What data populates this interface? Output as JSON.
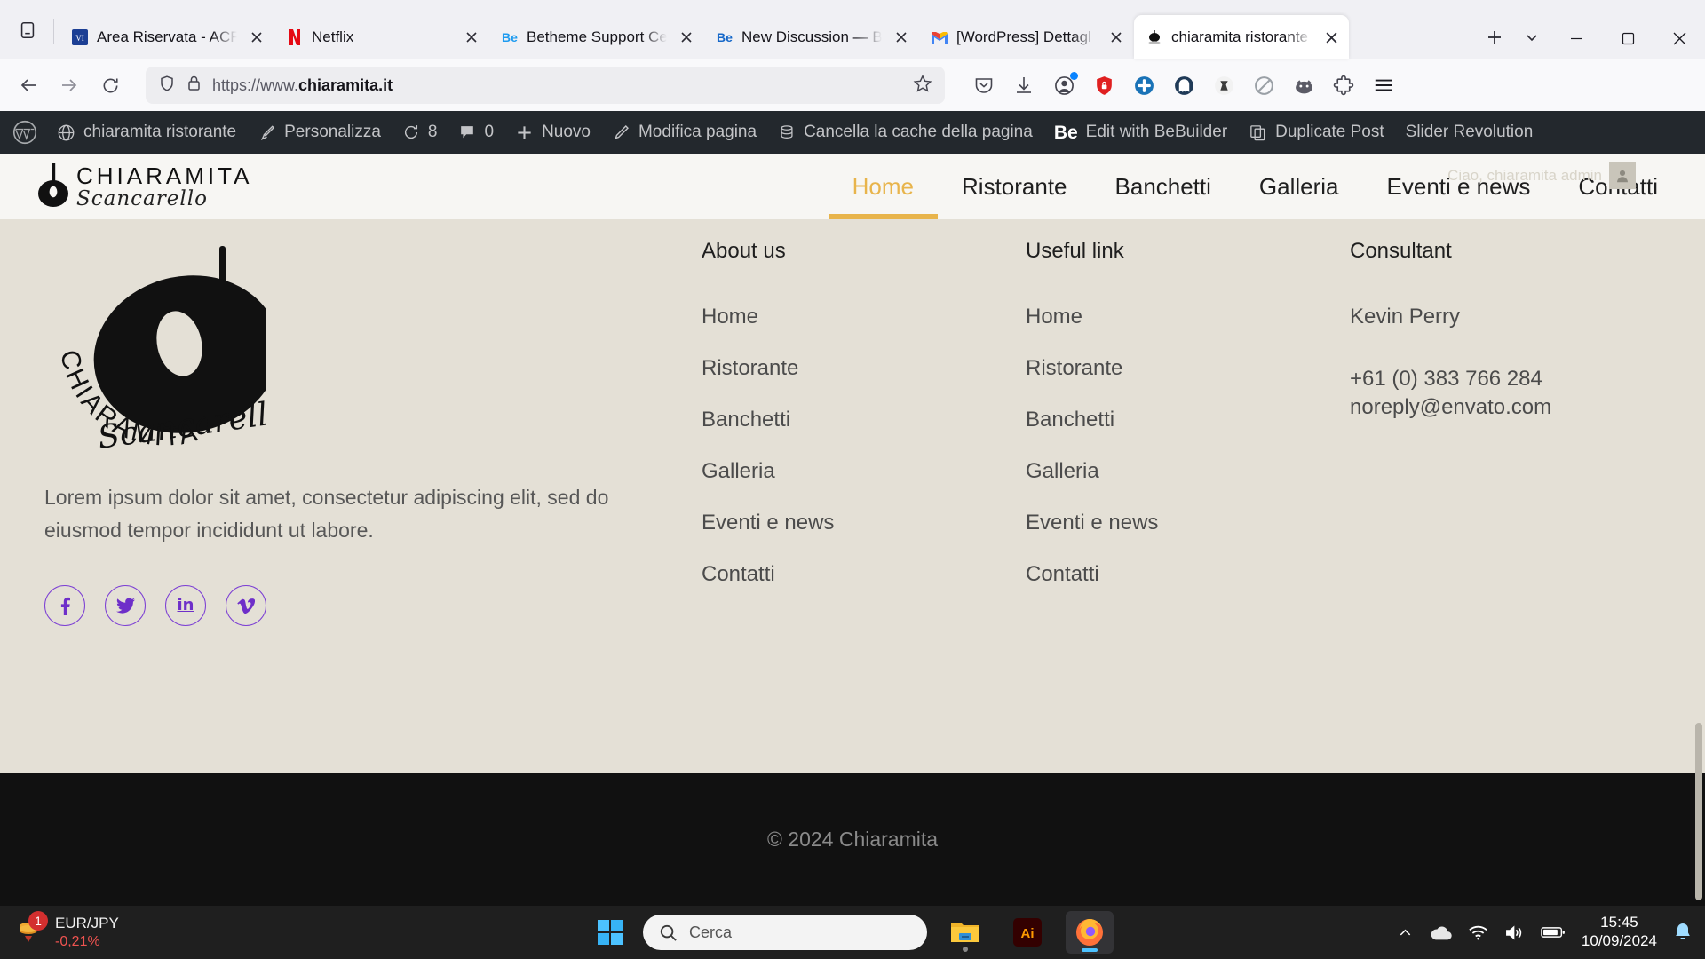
{
  "browser": {
    "tabs": [
      {
        "title": "Area Riservata - ACF",
        "favicon": "wordpress-vip-icon",
        "active": false
      },
      {
        "title": "Netflix",
        "favicon": "netflix-icon",
        "active": false
      },
      {
        "title": "Betheme Support Ce",
        "favicon": "betheme-icon",
        "active": false
      },
      {
        "title": "New Discussion — B",
        "favicon": "betheme-icon",
        "active": false
      },
      {
        "title": "[WordPress] Dettagl",
        "favicon": "gmail-icon",
        "active": false
      },
      {
        "title": "chiaramita ristorante",
        "favicon": "chiaramita-icon",
        "active": true
      }
    ],
    "new_tab_label": "+",
    "url": {
      "prefix": "https://www.",
      "domain": "chiaramita.it"
    },
    "window_controls": {
      "minimize": "—",
      "maximize": "❐",
      "close": "✕"
    }
  },
  "wpbar": {
    "items": [
      {
        "icon": "wordpress-logo-icon",
        "label": ""
      },
      {
        "icon": "site-icon",
        "label": "chiaramita ristorante"
      },
      {
        "icon": "brush-icon",
        "label": "Personalizza"
      },
      {
        "icon": "update-icon",
        "label": "8"
      },
      {
        "icon": "comment-icon",
        "label": "0"
      },
      {
        "icon": "plus-icon",
        "label": "Nuovo"
      },
      {
        "icon": "pencil-icon",
        "label": "Modifica pagina"
      },
      {
        "icon": "database-icon",
        "label": "Cancella la cache della pagina"
      },
      {
        "icon": "betheme-icon",
        "label": "Edit with BeBuilder"
      },
      {
        "icon": "duplicate-icon",
        "label": "Duplicate Post"
      },
      {
        "icon": "",
        "label": "Slider Revolution"
      }
    ]
  },
  "site": {
    "brand": {
      "name": "CHIARAMITA",
      "sub": "Scancarello"
    },
    "nav": [
      {
        "label": "Home",
        "active": true
      },
      {
        "label": "Ristorante",
        "active": false
      },
      {
        "label": "Banchetti",
        "active": false
      },
      {
        "label": "Galleria",
        "active": false
      },
      {
        "label": "Eventi e news",
        "active": false
      },
      {
        "label": "Contatti",
        "active": false
      }
    ],
    "greeting": "Ciao, chiaramita admin",
    "footer": {
      "tagline": "Lorem ipsum dolor sit amet, consectetur adipiscing elit, sed do eiusmod tempor incididunt ut labore.",
      "socials": [
        {
          "name": "facebook-icon",
          "glyph": "f"
        },
        {
          "name": "twitter-icon",
          "glyph": "ᴠ"
        },
        {
          "name": "linkedin-icon",
          "glyph": "in"
        },
        {
          "name": "vimeo-icon",
          "glyph": "v"
        }
      ],
      "columns": [
        {
          "title": "About us",
          "links": [
            "Home",
            "Ristorante",
            "Banchetti",
            "Galleria",
            "Eventi e news",
            "Contatti"
          ]
        },
        {
          "title": "Useful link",
          "links": [
            "Home",
            "Ristorante",
            "Banchetti",
            "Galleria",
            "Eventi e news",
            "Contatti"
          ]
        }
      ],
      "consultant": {
        "title": "Consultant",
        "name": "Kevin Perry",
        "phone": "+61 (0) 383 766 284",
        "email": "noreply@envato.com"
      },
      "copyright": "© 2024 Chiaramita"
    }
  },
  "taskbar": {
    "widget": {
      "badge": "1",
      "pair": "EUR/JPY",
      "change": "-0,21%"
    },
    "search_placeholder": "Cerca",
    "apps": [
      {
        "name": "file-explorer-icon"
      },
      {
        "name": "illustrator-icon"
      },
      {
        "name": "firefox-icon"
      }
    ],
    "clock": {
      "time": "15:45",
      "date": "10/09/2024"
    },
    "colors": {
      "accent": "#4cc2ff",
      "taskbar_bg": "#1f1f1f"
    }
  },
  "colors": {
    "site_bg": "#e4e0d6",
    "header_bg": "#f7f6f3",
    "accent_yellow": "#e8b44b",
    "social_purple": "#6e2fc9",
    "footer_dark": "#111111"
  }
}
